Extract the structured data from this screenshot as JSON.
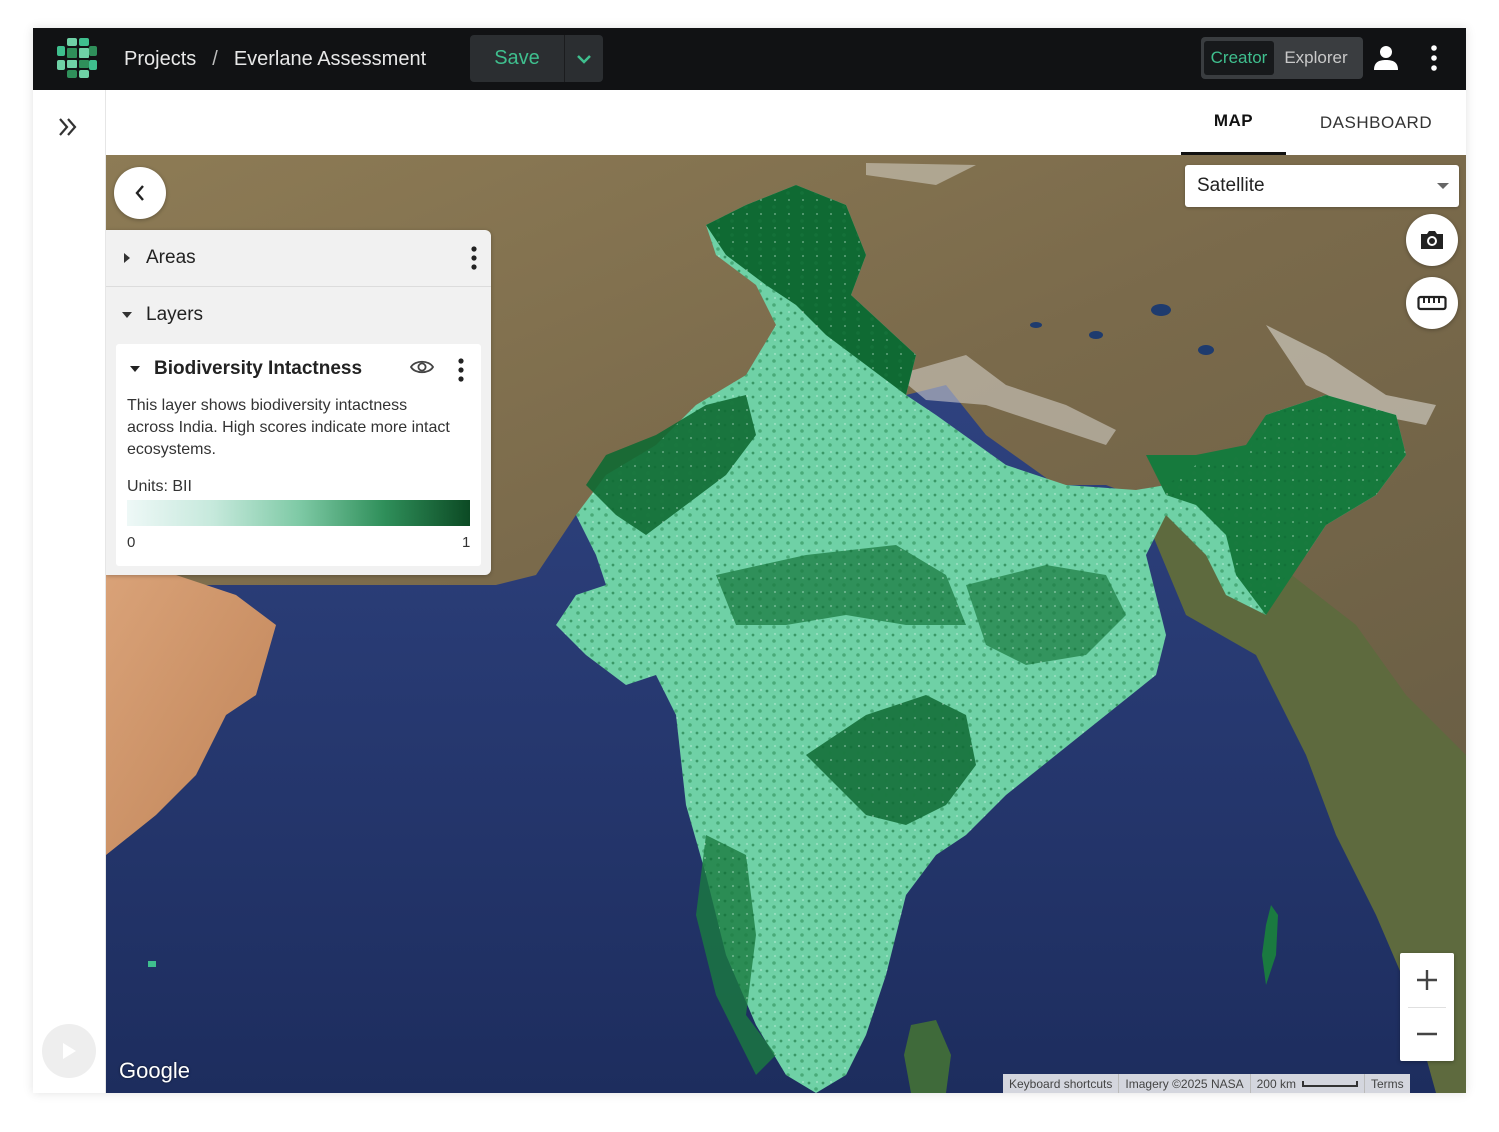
{
  "header": {
    "breadcrumb_root": "Projects",
    "breadcrumb_sep": "/",
    "project_name": "Everlane Assessment",
    "save_label": "Save",
    "modes": [
      "Creator",
      "Explorer"
    ],
    "active_mode": "Creator"
  },
  "tabs": [
    {
      "label": "MAP",
      "active": true
    },
    {
      "label": "DASHBOARD",
      "active": false
    }
  ],
  "panel": {
    "areas_label": "Areas",
    "layers_label": "Layers",
    "layer": {
      "title": "Biodiversity Intactness",
      "description": "This layer shows biodiversity intactness across India. High scores indicate more intact ecosystems.",
      "units": "Units: BII",
      "legend_min": "0",
      "legend_max": "1",
      "legend_colors": [
        "#eef8f7",
        "#c6e9dc",
        "#7fcaa6",
        "#2f8f5a",
        "#0c4a24"
      ]
    }
  },
  "map": {
    "basemap": "Satellite",
    "zoom_in": "+",
    "zoom_out": "−",
    "google_logo": "Google",
    "attribution": {
      "shortcuts": "Keyboard shortcuts",
      "imagery": "Imagery ©2025 NASA",
      "scale": "200 km",
      "terms": "Terms"
    }
  },
  "colors": {
    "accent": "#3fbf8e",
    "topbar": "#111214",
    "ocean": "#2a3f78",
    "land": "#8a7a5a",
    "layer_light": "#6fd1a6",
    "layer_dark": "#0f6a33"
  },
  "icons": {
    "logo": "app-logo-icon",
    "save_dropdown": "chevron-down-icon",
    "user": "user-icon",
    "menu": "kebab-icon",
    "expand": "double-chevron-right-icon",
    "play": "play-icon",
    "back": "chevron-left-icon",
    "visibility": "eye-icon",
    "camera": "camera-icon",
    "measure": "ruler-icon"
  }
}
